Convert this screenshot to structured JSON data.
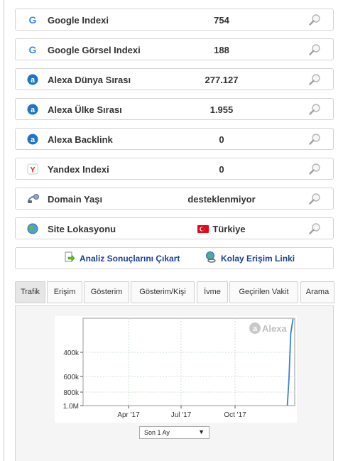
{
  "metrics": [
    {
      "icon": "google-icon",
      "label": "Google Indexi",
      "value": "754"
    },
    {
      "icon": "google-icon",
      "label": "Google Görsel Indexi",
      "value": "188"
    },
    {
      "icon": "alexa-icon",
      "label": "Alexa Dünya Sırası",
      "value": "277.127"
    },
    {
      "icon": "alexa-icon",
      "label": "Alexa Ülke Sırası",
      "value": "1.955"
    },
    {
      "icon": "alexa-icon",
      "label": "Alexa Backlink",
      "value": "0"
    },
    {
      "icon": "yandex-icon",
      "label": "Yandex Indexi",
      "value": "0"
    },
    {
      "icon": "domain-age-icon",
      "label": "Domain Yaşı",
      "value": "desteklenmiyor"
    },
    {
      "icon": "globe-icon",
      "label": "Site Lokasyonu",
      "value": "Türkiye",
      "flag": "turkey-flag-icon"
    }
  ],
  "actions": {
    "export_label": "Analiz Sonuçlarını Çıkart",
    "link_label": "Kolay Erişim Linki"
  },
  "tabs": [
    "Trafik",
    "Erişim",
    "Gösterim",
    "Gösterim/Kişi",
    "İvme",
    "Geçirilen Vakit",
    "Arama"
  ],
  "active_tab": "Trafik",
  "colors": {
    "line": "#3a7fd5",
    "link": "#1c3f94",
    "flag": "#e30a17"
  },
  "chart_data": {
    "type": "line",
    "watermark": "Alexa",
    "y_scale": "reciprocal (inverted rank)",
    "y_ticks": [
      "400k",
      "600k",
      "800k",
      "1.0M"
    ],
    "x_ticks": [
      "Apr '17",
      "Jul '17",
      "Oct '17"
    ],
    "grid": true,
    "series": [
      {
        "values": [
          {
            "x": "2017-12-28",
            "y": 1000000
          },
          {
            "x": "2017-12-31",
            "y": 560000
          },
          {
            "x": "2018-01-03",
            "y": 330000
          },
          {
            "x": "2018-01-07",
            "y": 277127
          }
        ]
      }
    ]
  },
  "period_select": {
    "value": "Son 1 Ay"
  }
}
